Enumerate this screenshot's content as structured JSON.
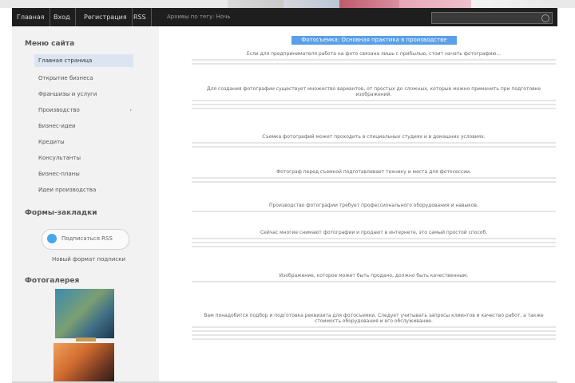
{
  "nav": {
    "items": [
      "Главная",
      "Вход",
      "Регистрация",
      "RSS"
    ],
    "current": "Архивы по тегу: Ночь"
  },
  "sidebar": {
    "menu_heading": "Меню сайта",
    "menu_items": [
      {
        "label": "Главная страница",
        "active": true
      },
      {
        "label": "Открытие бизнеса",
        "active": false
      },
      {
        "label": "Франшизы и услуги",
        "active": false
      },
      {
        "label": "Производство",
        "active": false,
        "has_submenu": true
      },
      {
        "label": "Бизнес-идеи",
        "active": false
      },
      {
        "label": "Кредиты",
        "active": false
      },
      {
        "label": "Консультанты",
        "active": false
      },
      {
        "label": "Бизнес-планы",
        "active": false
      },
      {
        "label": "Идеи производства",
        "active": false
      }
    ],
    "subscribe_heading": "Формы-закладки",
    "subscribe_button": "Подписаться RSS",
    "subscribe_link": "Новый формат подписки",
    "photos_heading": "Фотогалерея"
  },
  "article": {
    "title": "Фотосъемка: Основная практика в производстве",
    "paragraphs": [
      "Если для предпринимателя работа на фото связана лишь с прибылью, стоит начать фотографию...",
      "Для создания фотографии существует множество вариантов, от простых до сложных, которые можно применить при подготовке изображений.",
      "Съемка фотографий может проходить в специальных студиях и в домашних условиях.",
      "Фотограф перед съемкой подготавливает технику и места для фотосессии.",
      "Производство фотографии требует профессионального оборудования и навыков.",
      "Сейчас многие снимают фотографии и продают в интернете, это самый простой способ.",
      "Изображение, которое может быть продано, должно быть качественным.",
      "Вам понадобится подбор и подготовка реквизита для фотосъемки. Следует учитывать запросы клиентов и качество работ, а также стоимость оборудования и его обслуживание."
    ]
  },
  "colors": {
    "navbar": "#1e1e1e",
    "sidebar_bg": "#f2f2f2",
    "active_item": "#dbe5f2",
    "title_highlight": "#5aa0e8",
    "rss_icon": "#49a6e8"
  },
  "icons": {
    "search": "search-icon",
    "feed": "feed-icon"
  }
}
